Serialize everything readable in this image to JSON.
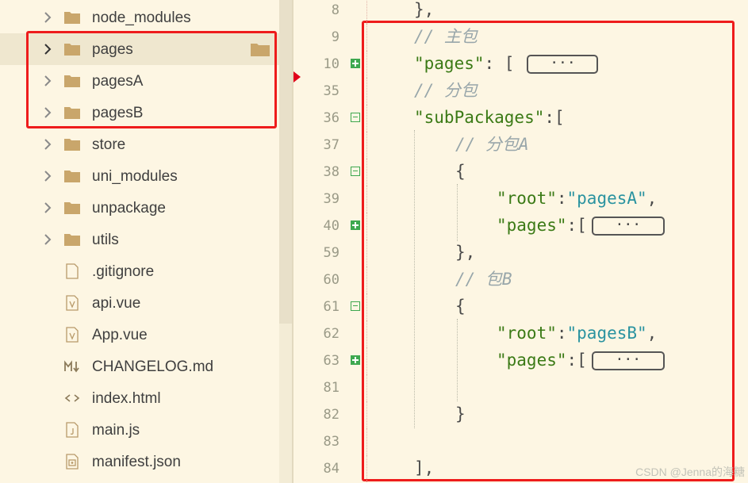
{
  "file_tree": {
    "items": [
      {
        "name": "node_modules",
        "type": "folder",
        "icon": "folder-icon",
        "chevron": true
      },
      {
        "name": "pages",
        "type": "folder",
        "icon": "folder-icon",
        "chevron": true,
        "selected": true
      },
      {
        "name": "pagesA",
        "type": "folder",
        "icon": "folder-icon",
        "chevron": true
      },
      {
        "name": "pagesB",
        "type": "folder",
        "icon": "folder-icon",
        "chevron": true
      },
      {
        "name": "store",
        "type": "folder",
        "icon": "folder-icon",
        "chevron": true
      },
      {
        "name": "uni_modules",
        "type": "folder",
        "icon": "folder-icon",
        "chevron": true
      },
      {
        "name": "unpackage",
        "type": "folder",
        "icon": "folder-icon",
        "chevron": true
      },
      {
        "name": "utils",
        "type": "folder",
        "icon": "folder-icon",
        "chevron": true
      },
      {
        "name": ".gitignore",
        "type": "file",
        "icon": "file-icon",
        "chevron": false
      },
      {
        "name": "api.vue",
        "type": "file",
        "icon": "vue-file-icon",
        "chevron": false
      },
      {
        "name": "App.vue",
        "type": "file",
        "icon": "vue-file-icon",
        "chevron": false
      },
      {
        "name": "CHANGELOG.md",
        "type": "file",
        "icon": "markdown-file-icon",
        "chevron": false
      },
      {
        "name": "index.html",
        "type": "file",
        "icon": "html-file-icon",
        "chevron": false
      },
      {
        "name": "main.js",
        "type": "file",
        "icon": "js-file-icon",
        "chevron": false
      },
      {
        "name": "manifest.json",
        "type": "file",
        "icon": "json-file-icon",
        "chevron": false
      }
    ]
  },
  "editor": {
    "collapsed_placeholder": "···",
    "lines": [
      {
        "num": "8",
        "fold": "",
        "parts": [
          [
            "pun",
            "},"
          ]
        ]
      },
      {
        "num": "9",
        "fold": "",
        "parts": [
          [
            "comment",
            "// 主包"
          ]
        ]
      },
      {
        "num": "10",
        "fold": "exp",
        "parts": [
          [
            "key",
            "\"pages\""
          ],
          [
            "pun",
            ": ["
          ]
        ],
        "collapsed": true
      },
      {
        "num": "35",
        "fold": "",
        "parts": [
          [
            "comment",
            "// 分包"
          ]
        ]
      },
      {
        "num": "36",
        "fold": "col",
        "parts": [
          [
            "key",
            "\"subPackages\""
          ],
          [
            "pun",
            ":["
          ]
        ]
      },
      {
        "num": "37",
        "fold": "",
        "parts": [
          [
            "comment",
            "// 分包A"
          ]
        ]
      },
      {
        "num": "38",
        "fold": "col",
        "parts": [
          [
            "pun",
            "{"
          ]
        ]
      },
      {
        "num": "39",
        "fold": "",
        "parts": [
          [
            "key",
            "\"root\""
          ],
          [
            "pun",
            ":"
          ],
          [
            "str",
            "\"pagesA\""
          ],
          [
            "pun",
            ","
          ]
        ]
      },
      {
        "num": "40",
        "fold": "exp",
        "parts": [
          [
            "key",
            "\"pages\""
          ],
          [
            "pun",
            ":["
          ]
        ],
        "collapsed": true
      },
      {
        "num": "59",
        "fold": "",
        "parts": [
          [
            "pun",
            "},"
          ]
        ]
      },
      {
        "num": "60",
        "fold": "",
        "parts": [
          [
            "comment",
            "// 包B"
          ]
        ]
      },
      {
        "num": "61",
        "fold": "col",
        "parts": [
          [
            "pun",
            "{"
          ]
        ]
      },
      {
        "num": "62",
        "fold": "",
        "parts": [
          [
            "key",
            "\"root\""
          ],
          [
            "pun",
            ":"
          ],
          [
            "str",
            "\"pagesB\""
          ],
          [
            "pun",
            ","
          ]
        ]
      },
      {
        "num": "63",
        "fold": "exp",
        "parts": [
          [
            "key",
            "\"pages\""
          ],
          [
            "pun",
            ":["
          ]
        ],
        "collapsed": true
      },
      {
        "num": "81",
        "fold": "",
        "parts": []
      },
      {
        "num": "82",
        "fold": "",
        "parts": [
          [
            "pun",
            "}"
          ]
        ]
      },
      {
        "num": "83",
        "fold": "",
        "parts": []
      },
      {
        "num": "84",
        "fold": "",
        "parts": [
          [
            "pun",
            "],"
          ]
        ]
      }
    ]
  },
  "watermark": "CSDN @Jenna的海糖",
  "colors": {
    "background": "#fdf6e3",
    "highlight_box": "#ee1c1c",
    "fold_marker": "#3ea84f",
    "json_key": "#3b7a16",
    "json_string": "#2a93a0",
    "comment": "#98a6aa"
  }
}
